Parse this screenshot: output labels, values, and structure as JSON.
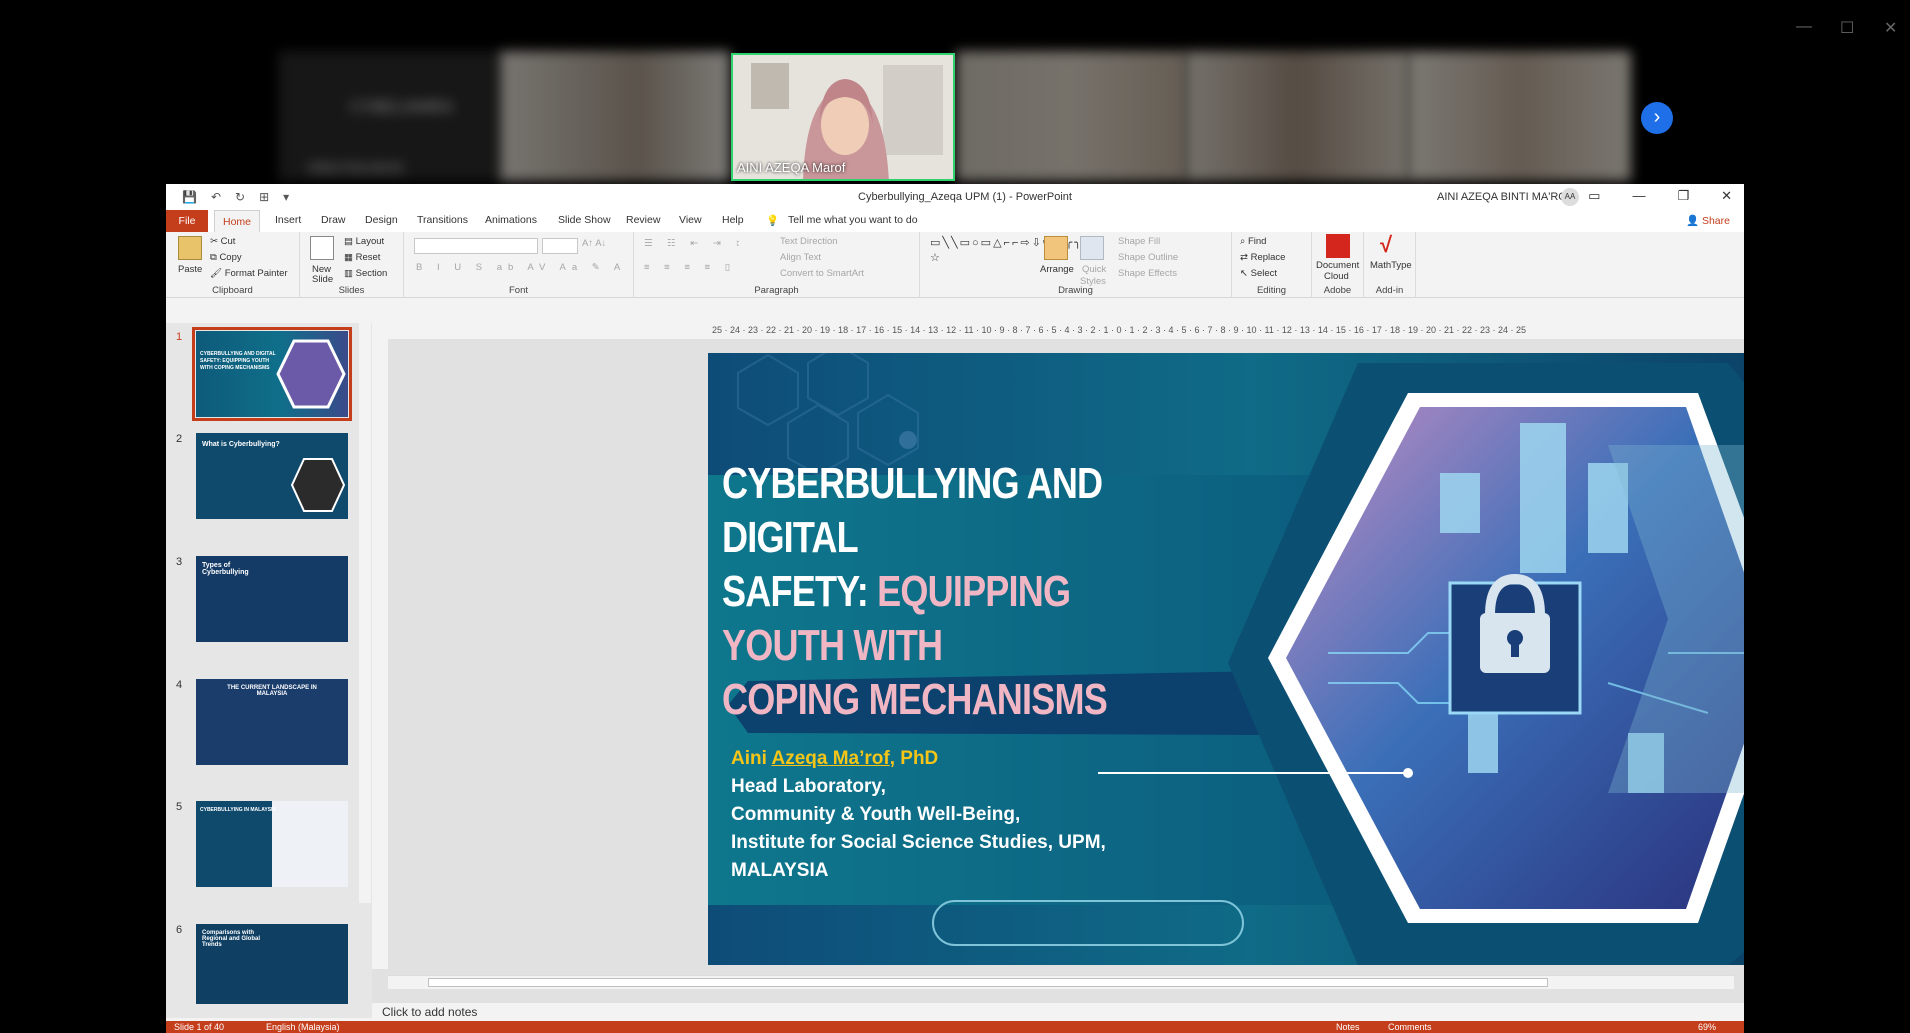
{
  "meeting": {
    "speaker_name": "AINI AZEQA Marof",
    "participant_1_name": "CYBELIAMRA",
    "participant_2_name": "NINA FAILAKAS",
    "next_icon": "chevron-right-icon"
  },
  "window": {
    "doc_title": "Cyberbullying_Azeqa UPM (1)  -  PowerPoint",
    "user_name": "AINI AZEQA BINTI MA'ROF",
    "user_initials": "AA"
  },
  "tabs": {
    "file": "File",
    "home": "Home",
    "insert": "Insert",
    "draw": "Draw",
    "design": "Design",
    "transitions": "Transitions",
    "animations": "Animations",
    "slideshow": "Slide Show",
    "review": "Review",
    "view": "View",
    "help": "Help",
    "tell_me": "Tell me what you want to do",
    "share": "Share"
  },
  "ribbon": {
    "clipboard": {
      "paste": "Paste",
      "cut": "Cut",
      "copy": "Copy",
      "format_painter": "Format Painter",
      "label": "Clipboard"
    },
    "slides": {
      "new_slide": "New",
      "new_slide2": "Slide",
      "layout": "Layout",
      "reset": "Reset",
      "section": "Section",
      "label": "Slides"
    },
    "font": {
      "label": "Font"
    },
    "paragraph": {
      "text_direction": "Text Direction",
      "align_text": "Align Text",
      "smartart": "Convert to SmartArt",
      "label": "Paragraph"
    },
    "drawing": {
      "arrange": "Arrange",
      "quick": "Quick",
      "styles": "Styles",
      "shape_fill": "Shape Fill",
      "shape_outline": "Shape Outline",
      "shape_effects": "Shape Effects",
      "label": "Drawing"
    },
    "editing": {
      "find": "Find",
      "replace": "Replace",
      "select": "Select",
      "label": "Editing"
    },
    "adobe": {
      "document": "Document",
      "cloud": "Cloud",
      "label": "Adobe"
    },
    "addin": {
      "mathtype": "MathType",
      "label": "Add-in"
    }
  },
  "ruler": {
    "horizontal": "25 · 24 · 23 · 22 · 21 · 20 · 19 · 18 · 17 · 16 · 15 · 14 · 13 · 12 · 11 · 10 · 9 · 8 · 7 · 6 · 5 · 4 · 3 · 2 · 1 · 0 · 1 · 2 · 3 · 4 · 5 · 6 · 7 · 8 · 9 · 10 · 11 · 12 · 13 · 14 · 15 · 16 · 17 · 18 · 19 · 20 · 21 · 22 · 23 · 24 · 25"
  },
  "thumbnails": [
    {
      "num": "1",
      "title": "CYBERBULLYING AND DIGITAL SAFETY: EQUIPPING YOUTH WITH COPING MECHANISMS"
    },
    {
      "num": "2",
      "title": "What is Cyberbullying?"
    },
    {
      "num": "3",
      "title": "Types of Cyberbullying"
    },
    {
      "num": "4",
      "title": "THE CURRENT LANDSCAPE IN MALAYSIA"
    },
    {
      "num": "5",
      "title": "CYBERBULLYING IN MALAYSIA"
    },
    {
      "num": "6",
      "title": "Comparisons with Regional and Global Trends"
    }
  ],
  "slide": {
    "title_line1": "CYBERBULLYING AND DIGITAL",
    "title_line2_white": "SAFETY: ",
    "title_line2_pink": "EQUIPPING YOUTH WITH",
    "title_line3": "COPING MECHANISMS",
    "author_first": "Aini ",
    "author_mid": "Azeqa Ma’rof",
    "author_suffix": ", PhD",
    "line1": "Head Laboratory,",
    "line2": "Community & Youth Well-Being,",
    "line3": "Institute for Social Science Studies, UPM,",
    "line4": "MALAYSIA"
  },
  "notes": {
    "placeholder": "Click to add notes"
  },
  "status": {
    "slide_count": "Slide 1 of 40",
    "language": "English (Malaysia)",
    "notes": "Notes",
    "comments": "Comments",
    "zoom": "69%"
  },
  "colors": {
    "accent": "#c43e1c",
    "slide_teal": "#0e6f8a",
    "pink": "#f0b6c4",
    "gold": "#f5c518"
  }
}
